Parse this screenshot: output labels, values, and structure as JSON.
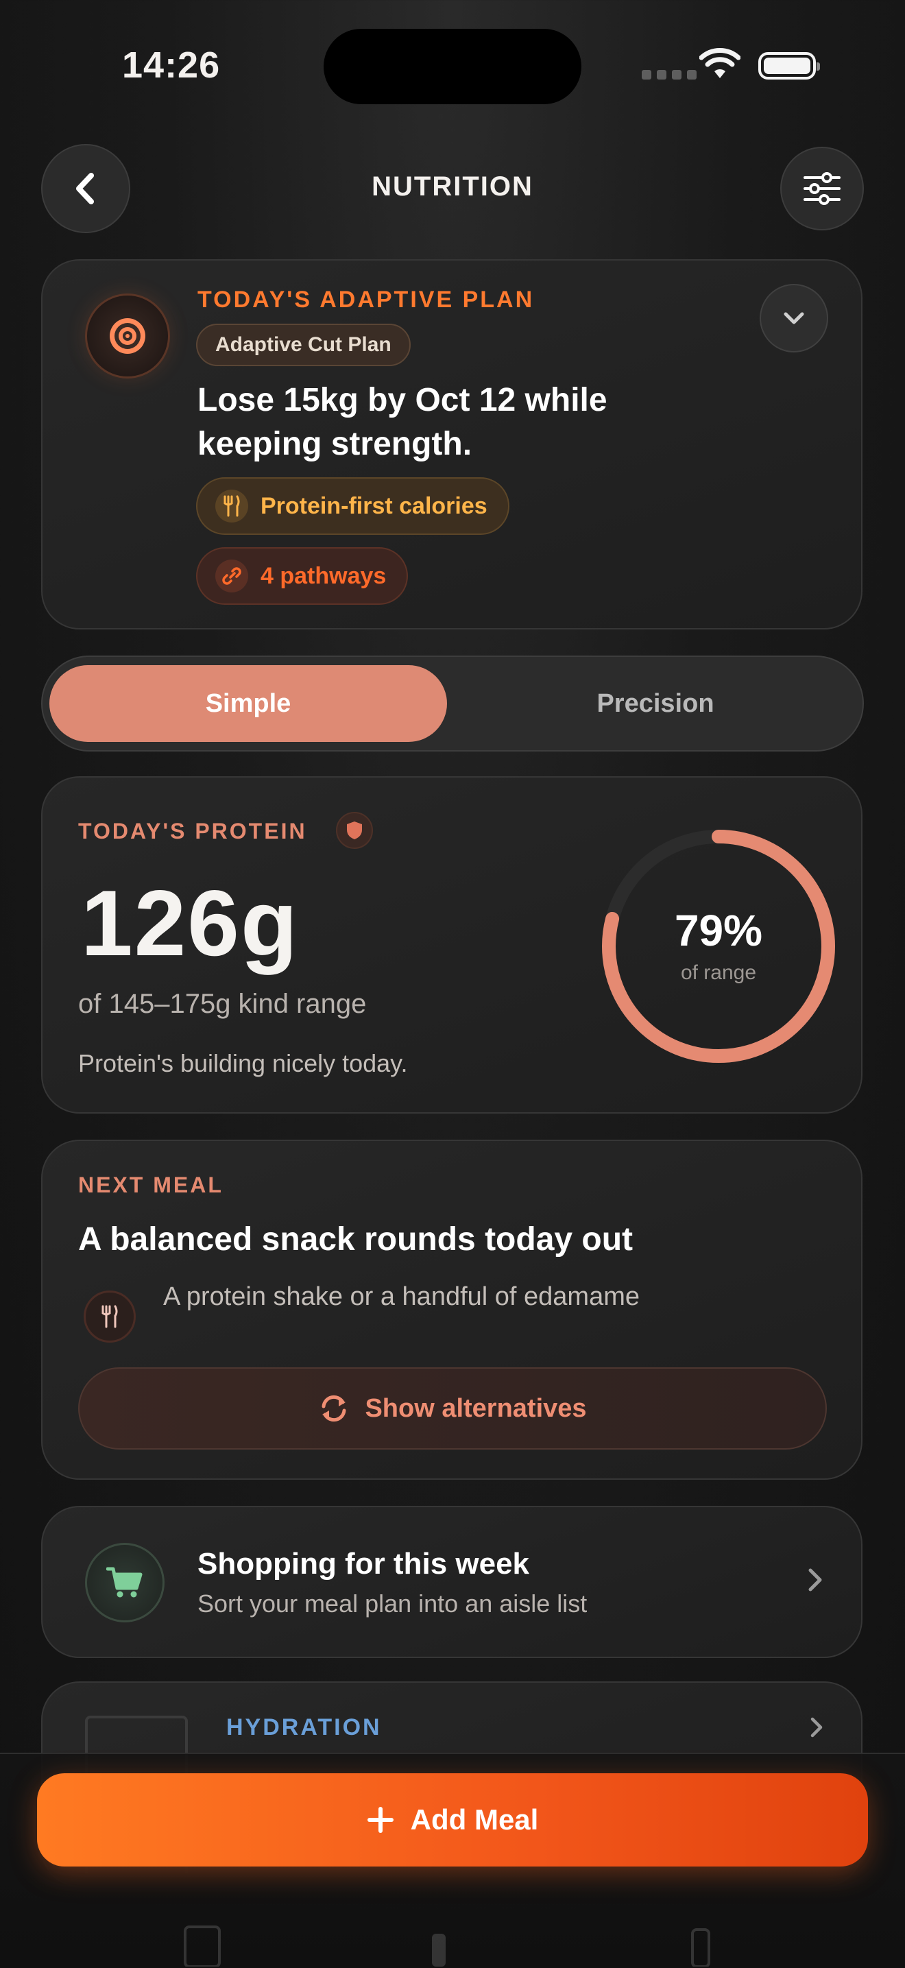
{
  "status_bar": {
    "time": "14:26"
  },
  "header": {
    "title": "NUTRITION"
  },
  "plan": {
    "eyebrow": "TODAY'S ADAPTIVE PLAN",
    "chip": "Adaptive Cut Plan",
    "goal": "Lose 15kg by Oct 12 while keeping strength.",
    "pills": [
      {
        "label": "Protein-first calories",
        "icon": "fork-knife-icon"
      },
      {
        "label": "4 pathways",
        "icon": "link-icon"
      }
    ]
  },
  "segmented": {
    "options": [
      "Simple",
      "Precision"
    ],
    "selected": "Simple"
  },
  "protein": {
    "eyebrow": "TODAY'S PROTEIN",
    "value": "126g",
    "range": "of 145–175g kind range",
    "note": "Protein's building nicely today.",
    "ring_percent": "79%",
    "ring_fraction": 0.79,
    "ring_label": "of range"
  },
  "next_meal": {
    "eyebrow": "NEXT MEAL",
    "title": "A balanced snack rounds today out",
    "description": "A protein shake or a handful of edamame",
    "button": "Show alternatives"
  },
  "shopping": {
    "title": "Shopping for this week",
    "subtitle": "Sort your meal plan into an aisle list"
  },
  "hydration": {
    "eyebrow": "HYDRATION"
  },
  "add_meal": {
    "label": "Add Meal"
  },
  "colors": {
    "accent": "#ff7a2f",
    "salmon": "#de8a74",
    "amber": "#ffb54a",
    "hydration_blue": "#6a9fd8",
    "add_button": "#f2561a"
  }
}
